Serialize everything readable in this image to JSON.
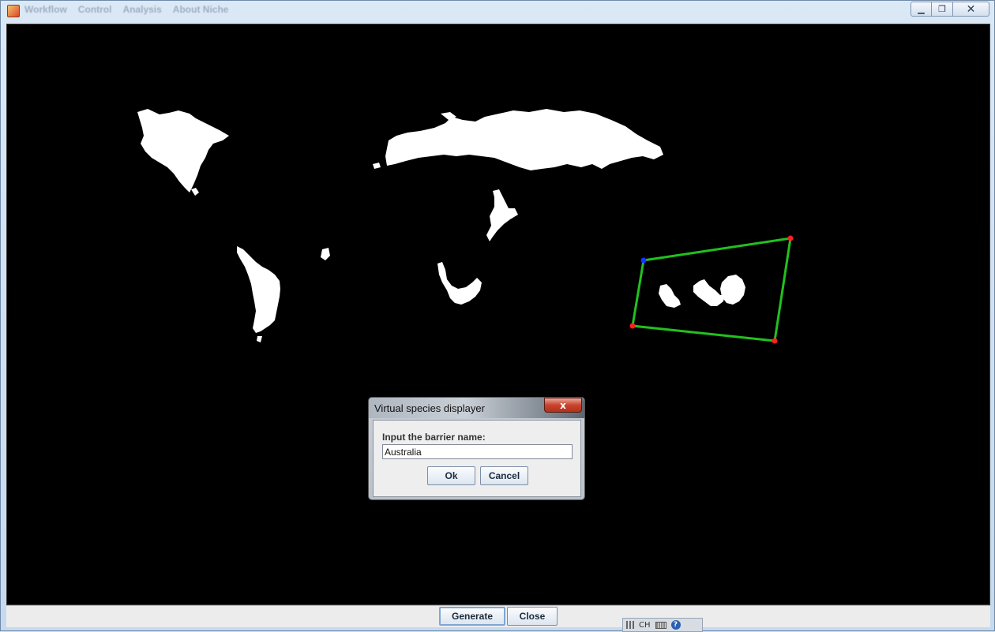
{
  "window": {
    "menu": [
      "Workflow",
      "Control",
      "Analysis",
      "About Niche"
    ],
    "controls": {
      "minimize": "▁",
      "maximize": "❐",
      "close": "✕"
    }
  },
  "map": {
    "background": "#000000",
    "landmass_color": "#ffffff",
    "barrier_polygon": {
      "line_color": "#22c01e",
      "vertex_color": "#ff2020",
      "start_vertex_color": "#1a33ff"
    }
  },
  "dialog": {
    "title": "Virtual species displayer",
    "close_label": "x",
    "prompt": "Input the barrier name:",
    "input_value": "Australia",
    "ok_label": "Ok",
    "cancel_label": "Cancel"
  },
  "bottom_bar": {
    "generate_label": "Generate",
    "close_label": "Close"
  },
  "taskbar": {
    "language": "CH",
    "help": "?"
  }
}
